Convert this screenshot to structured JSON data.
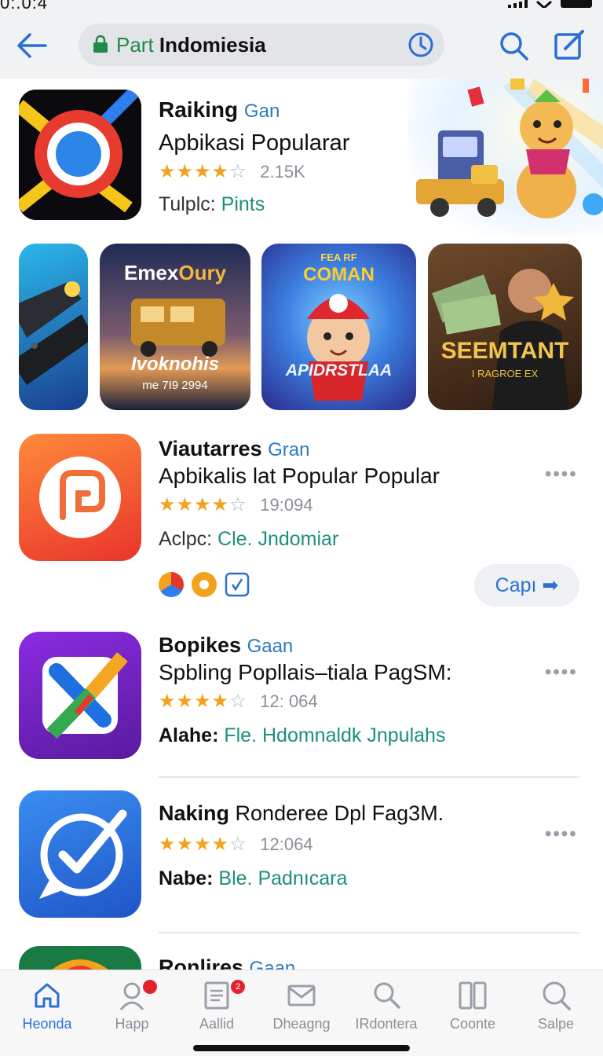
{
  "status_bar": {
    "time": "0:.0:4"
  },
  "header": {
    "search_prefix": "Part",
    "search_text": "Indomiesia"
  },
  "featured": {
    "name": "Raiking",
    "tag": "Gan",
    "subtitle": "Apbikasi Popularar",
    "stars": "★★★★",
    "stars_empty": "☆",
    "rating_count": "2.15K",
    "meta_label": "Tulplc:",
    "meta_value": "Pints"
  },
  "banners": [
    {
      "title_a": "Emex",
      "title_b": "Oury",
      "script": "Ivoknohis",
      "small": "me 7I9 2994"
    },
    {
      "top": "FEA  RF",
      "title": "COMAN",
      "bottom": "APIDRSTLAA"
    },
    {
      "title": "SEEMTANT",
      "small": "I RAGROE EX"
    }
  ],
  "apps": [
    {
      "name": "Viautarres",
      "tag": "Gran",
      "subtitle": "Apbikalis lat Popular Popular",
      "stars": "★★★★",
      "stars_empty": "☆",
      "rating_count": "19:094",
      "meta_label": "Aclpc:",
      "meta_value": "Cle. Jndomiar",
      "more": "••••",
      "open_label": "Capı ➡"
    },
    {
      "name": "Bopikes",
      "tag": "Gaan",
      "subtitle": "Spbling Popllais–tiala PagSM:",
      "stars": "★★★★",
      "stars_empty": "☆",
      "rating_count": "12: 064",
      "meta_label": "Alahe:",
      "meta_value": "Fle. Hdomnaldk Jnpulahs",
      "more": "••••"
    },
    {
      "name": "Naking",
      "subtitle": "Ronderee Dpl Fag3M.",
      "stars": "★★★★",
      "stars_empty": "☆",
      "rating_count": "12:064",
      "meta_label": "Nabe:",
      "meta_value": "Ble. Padnıcara",
      "more": "••••"
    },
    {
      "name": "Ronlires",
      "tag": "Gaan"
    }
  ],
  "tabs": [
    {
      "label": "Heonda",
      "icon": "home-icon",
      "active": true
    },
    {
      "label": "Happ",
      "icon": "person-icon",
      "badge": ""
    },
    {
      "label": "Aallid",
      "icon": "document-icon",
      "badge": "2"
    },
    {
      "label": "Dheagng",
      "icon": "mail-icon"
    },
    {
      "label": "IRdontera",
      "icon": "search-icon"
    },
    {
      "label": "Coonte",
      "icon": "columns-icon"
    },
    {
      "label": "Salpe",
      "icon": "search-icon"
    }
  ],
  "colors": {
    "accent": "#2b6fd6",
    "green_text": "#1d8f7d",
    "star": "#f4a21d",
    "badge": "#e0242f"
  }
}
